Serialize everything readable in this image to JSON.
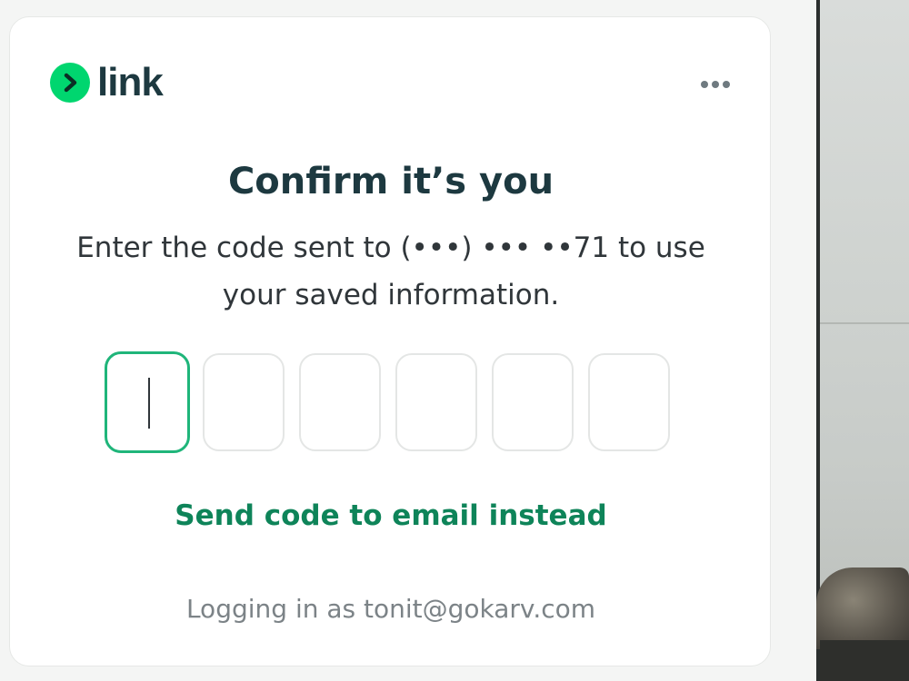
{
  "brand": {
    "name": "link",
    "logo_icon": "chevron-right-icon",
    "accent_color": "#00d66f",
    "text_color": "#1d3940"
  },
  "menu": {
    "icon": "more-horizontal-icon"
  },
  "dialog": {
    "title": "Confirm it’s you",
    "subtitle": "Enter the code sent to (•••) ••• ••71 to use your saved information.",
    "code_length": 6,
    "link_color": "#0e8459",
    "alt_action_label": "Send code to email instead",
    "footer_text": "Logging in as tonit@gokarv.com"
  }
}
